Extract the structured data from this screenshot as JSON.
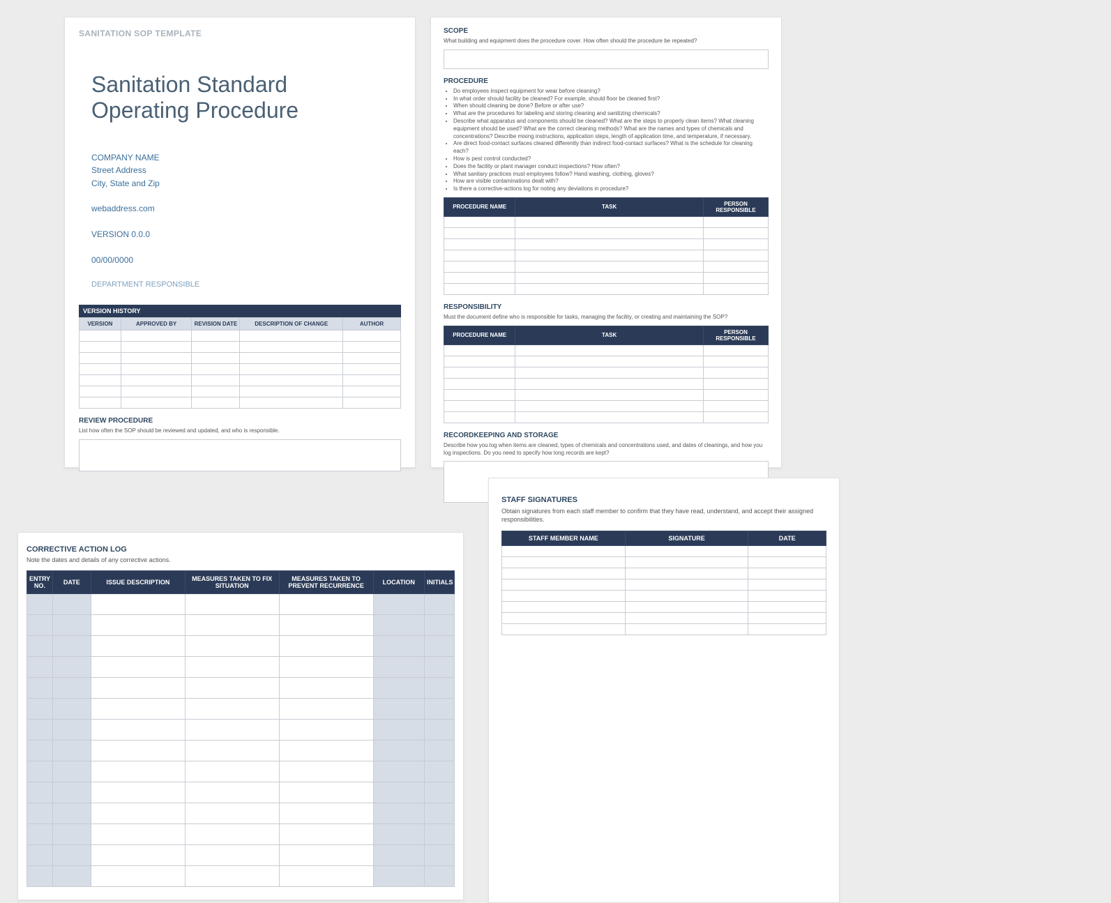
{
  "page1": {
    "template_header": "SANITATION SOP TEMPLATE",
    "title_line1": "Sanitation Standard",
    "title_line2": "Operating Procedure",
    "company_name": "COMPANY NAME",
    "street": "Street Address",
    "city": "City, State and Zip",
    "web": "webaddress.com",
    "version": "VERSION 0.0.0",
    "date": "00/00/0000",
    "department": "DEPARTMENT RESPONSIBLE",
    "version_history_band": "VERSION HISTORY",
    "vh_cols": [
      "VERSION",
      "APPROVED BY",
      "REVISION DATE",
      "DESCRIPTION OF CHANGE",
      "AUTHOR"
    ],
    "review_h": "REVIEW PROCEDURE",
    "review_desc": "List how often the SOP should be reviewed and updated, and who is responsible."
  },
  "page2": {
    "scope_h": "SCOPE",
    "scope_desc": "What building and equipment does the procedure cover. How often should the procedure be repeated?",
    "proc_h": "PROCEDURE",
    "proc_bullets": [
      "Do employees inspect equipment for wear before cleaning?",
      "In what order should facility be cleaned? For example, should floor be cleaned first?",
      "When should cleaning be done? Before or after use?",
      "What are the procedures for labeling and storing cleaning and sanitizing chemicals?",
      "Describe what apparatus and components should be cleaned? What are the steps to properly clean items? What cleaning equipment should be used? What are the correct cleaning methods? What are the names and types of chemicals and concentrations? Describe mixing instructions, application steps, length of application time, and temperature, if necessary.",
      "Are direct food-contact surfaces cleaned differently than indirect food-contact surfaces? What is the schedule for cleaning each?",
      "How is pest control conducted?",
      "Does the facility or plant manager conduct inspections? How often?",
      "What sanitary practices must employees follow? Hand washing, clothing, gloves?",
      "How are visible contaminations dealt with?",
      "Is there a corrective-actions log for noting any deviations in procedure?"
    ],
    "proc_table_cols": [
      "PROCEDURE NAME",
      "TASK",
      "PERSON RESPONSIBLE"
    ],
    "resp_h": "RESPONSIBILITY",
    "resp_desc": "Must the document define who is responsible for tasks, managing the facility, or creating and maintaining the SOP?",
    "record_h": "RECORDKEEPING AND STORAGE",
    "record_desc": "Describe how you log when items are cleaned, types of chemicals and concentrations used, and dates of cleanings, and how you log inspections. Do you need to specify how long records are kept?"
  },
  "page3": {
    "h": "CORRECTIVE ACTION LOG",
    "d": "Note the dates and details of any corrective actions.",
    "cols": [
      "ENTRY NO.",
      "DATE",
      "ISSUE DESCRIPTION",
      "MEASURES TAKEN TO FIX SITUATION",
      "MEASURES TAKEN TO PREVENT RECURRENCE",
      "LOCATION",
      "INITIALS"
    ]
  },
  "page4": {
    "h": "STAFF SIGNATURES",
    "d": "Obtain signatures from each staff member to confirm that they have read, understand, and accept their assigned responsibilities.",
    "cols": [
      "STAFF MEMBER NAME",
      "SIGNATURE",
      "DATE"
    ]
  }
}
